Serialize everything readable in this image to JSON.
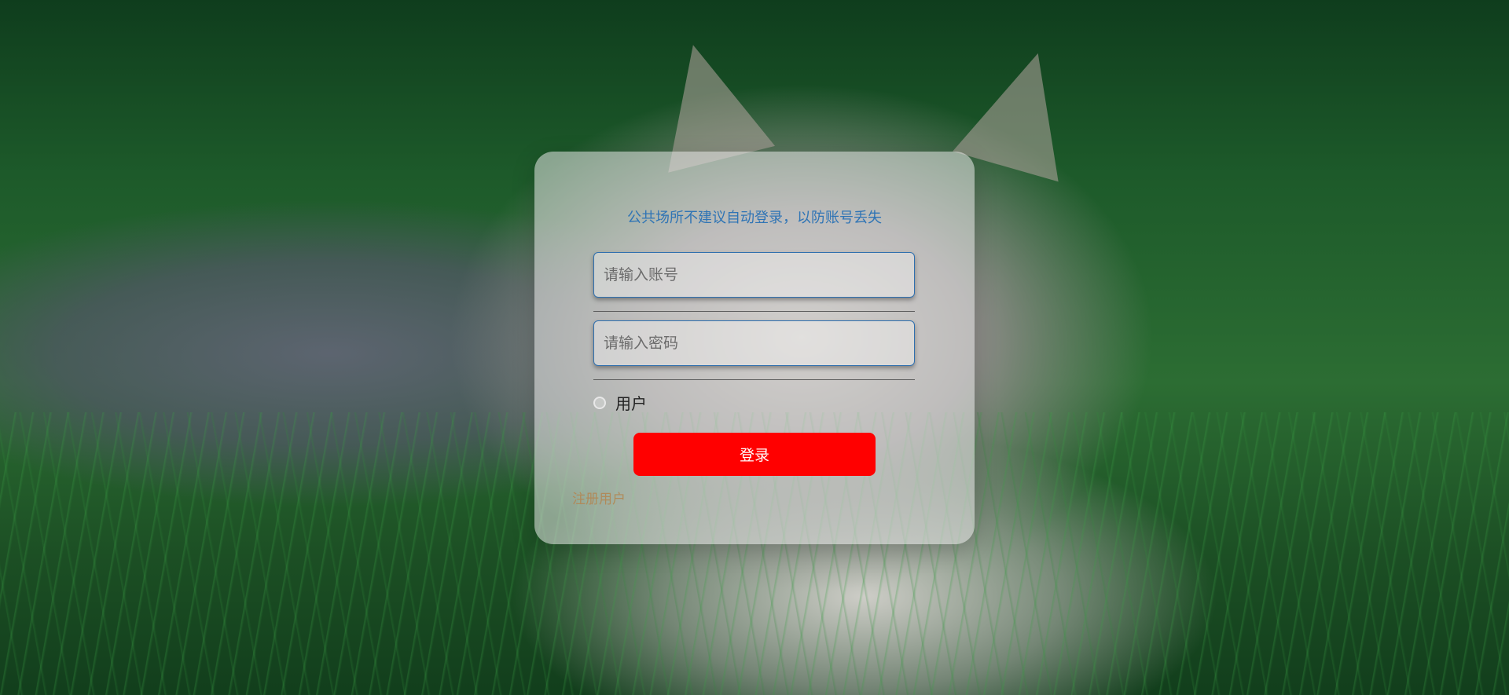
{
  "login": {
    "notice": "公共场所不建议自动登录，以防账号丢失",
    "account_placeholder": "请输入账号",
    "password_placeholder": "请输入密码",
    "role_label": "用户",
    "login_button_label": "登录",
    "register_link_label": "注册用户"
  },
  "colors": {
    "login_button": "#ff0000",
    "notice_text": "#2f74b5",
    "register_link": "#b08a5a"
  }
}
